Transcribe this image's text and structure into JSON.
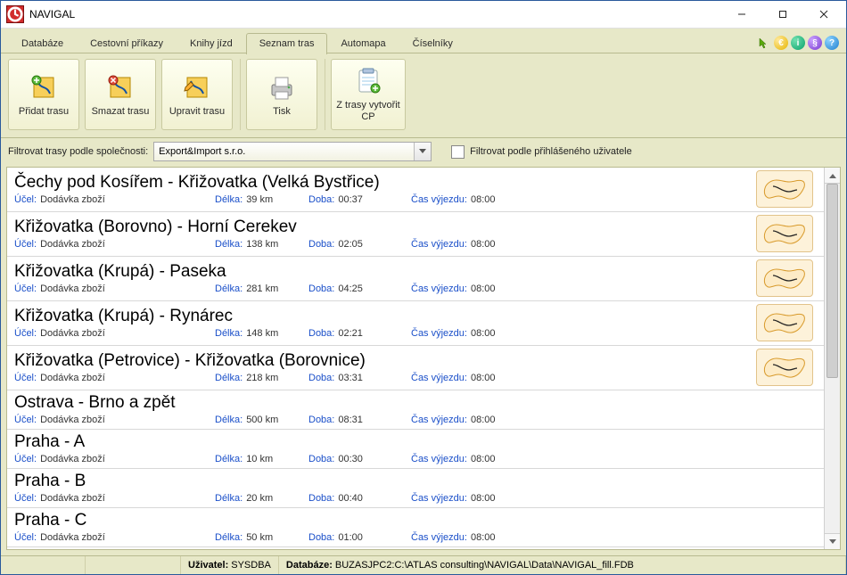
{
  "window": {
    "title": "NAVIGAL"
  },
  "tabs": [
    {
      "label": "Databáze"
    },
    {
      "label": "Cestovní příkazy"
    },
    {
      "label": "Knihy jízd"
    },
    {
      "label": "Seznam tras",
      "active": true
    },
    {
      "label": "Automapa"
    },
    {
      "label": "Číselníky"
    }
  ],
  "ribbon": {
    "add": {
      "label": "Přidat trasu"
    },
    "delete": {
      "label": "Smazat trasu"
    },
    "edit": {
      "label": "Upravit trasu"
    },
    "print": {
      "label": "Tisk"
    },
    "cp": {
      "label": "Z trasy vytvořit CP"
    }
  },
  "filter": {
    "label": "Filtrovat trasy podle společnosti:",
    "value": "Export&Import s.r.o.",
    "user_checkbox_label": "Filtrovat podle přihlášeného uživatele",
    "user_checkbox_checked": false
  },
  "field_labels": {
    "ucel": "Účel:",
    "delka": "Délka:",
    "doba": "Doba:",
    "cas": "Čas výjezdu:"
  },
  "routes": [
    {
      "title": "Čechy pod Kosířem - Křižovatka (Velká Bystřice)",
      "ucel": "Dodávka zboží",
      "delka": "39 km",
      "doba": "00:37",
      "cas": "08:00",
      "map": true
    },
    {
      "title": "Křižovatka (Borovno) - Horní Cerekev",
      "ucel": "Dodávka zboží",
      "delka": "138 km",
      "doba": "02:05",
      "cas": "08:00",
      "map": true
    },
    {
      "title": "Křižovatka (Krupá) - Paseka",
      "ucel": "Dodávka zboží",
      "delka": "281 km",
      "doba": "04:25",
      "cas": "08:00",
      "map": true
    },
    {
      "title": "Křižovatka (Krupá) - Rynárec",
      "ucel": "Dodávka zboží",
      "delka": "148 km",
      "doba": "02:21",
      "cas": "08:00",
      "map": true
    },
    {
      "title": "Křižovatka (Petrovice) - Křižovatka (Borovnice)",
      "ucel": "Dodávka zboží",
      "delka": "218 km",
      "doba": "03:31",
      "cas": "08:00",
      "map": true
    },
    {
      "title": "Ostrava - Brno a zpět",
      "ucel": "Dodávka zboží",
      "delka": "500 km",
      "doba": "08:31",
      "cas": "08:00",
      "map": false
    },
    {
      "title": "Praha - A",
      "ucel": "Dodávka zboží",
      "delka": "10 km",
      "doba": "00:30",
      "cas": "08:00",
      "map": false
    },
    {
      "title": "Praha - B",
      "ucel": "Dodávka zboží",
      "delka": "20 km",
      "doba": "00:40",
      "cas": "08:00",
      "map": false
    },
    {
      "title": "Praha - C",
      "ucel": "Dodávka zboží",
      "delka": "50 km",
      "doba": "01:00",
      "cas": "08:00",
      "map": false
    }
  ],
  "status": {
    "user_label": "Uživatel:",
    "user_value": "SYSDBA",
    "db_label": "Databáze:",
    "db_value": "BUZASJPC2:C:\\ATLAS consulting\\NAVIGAL\\Data\\NAVIGAL_fill.FDB"
  }
}
